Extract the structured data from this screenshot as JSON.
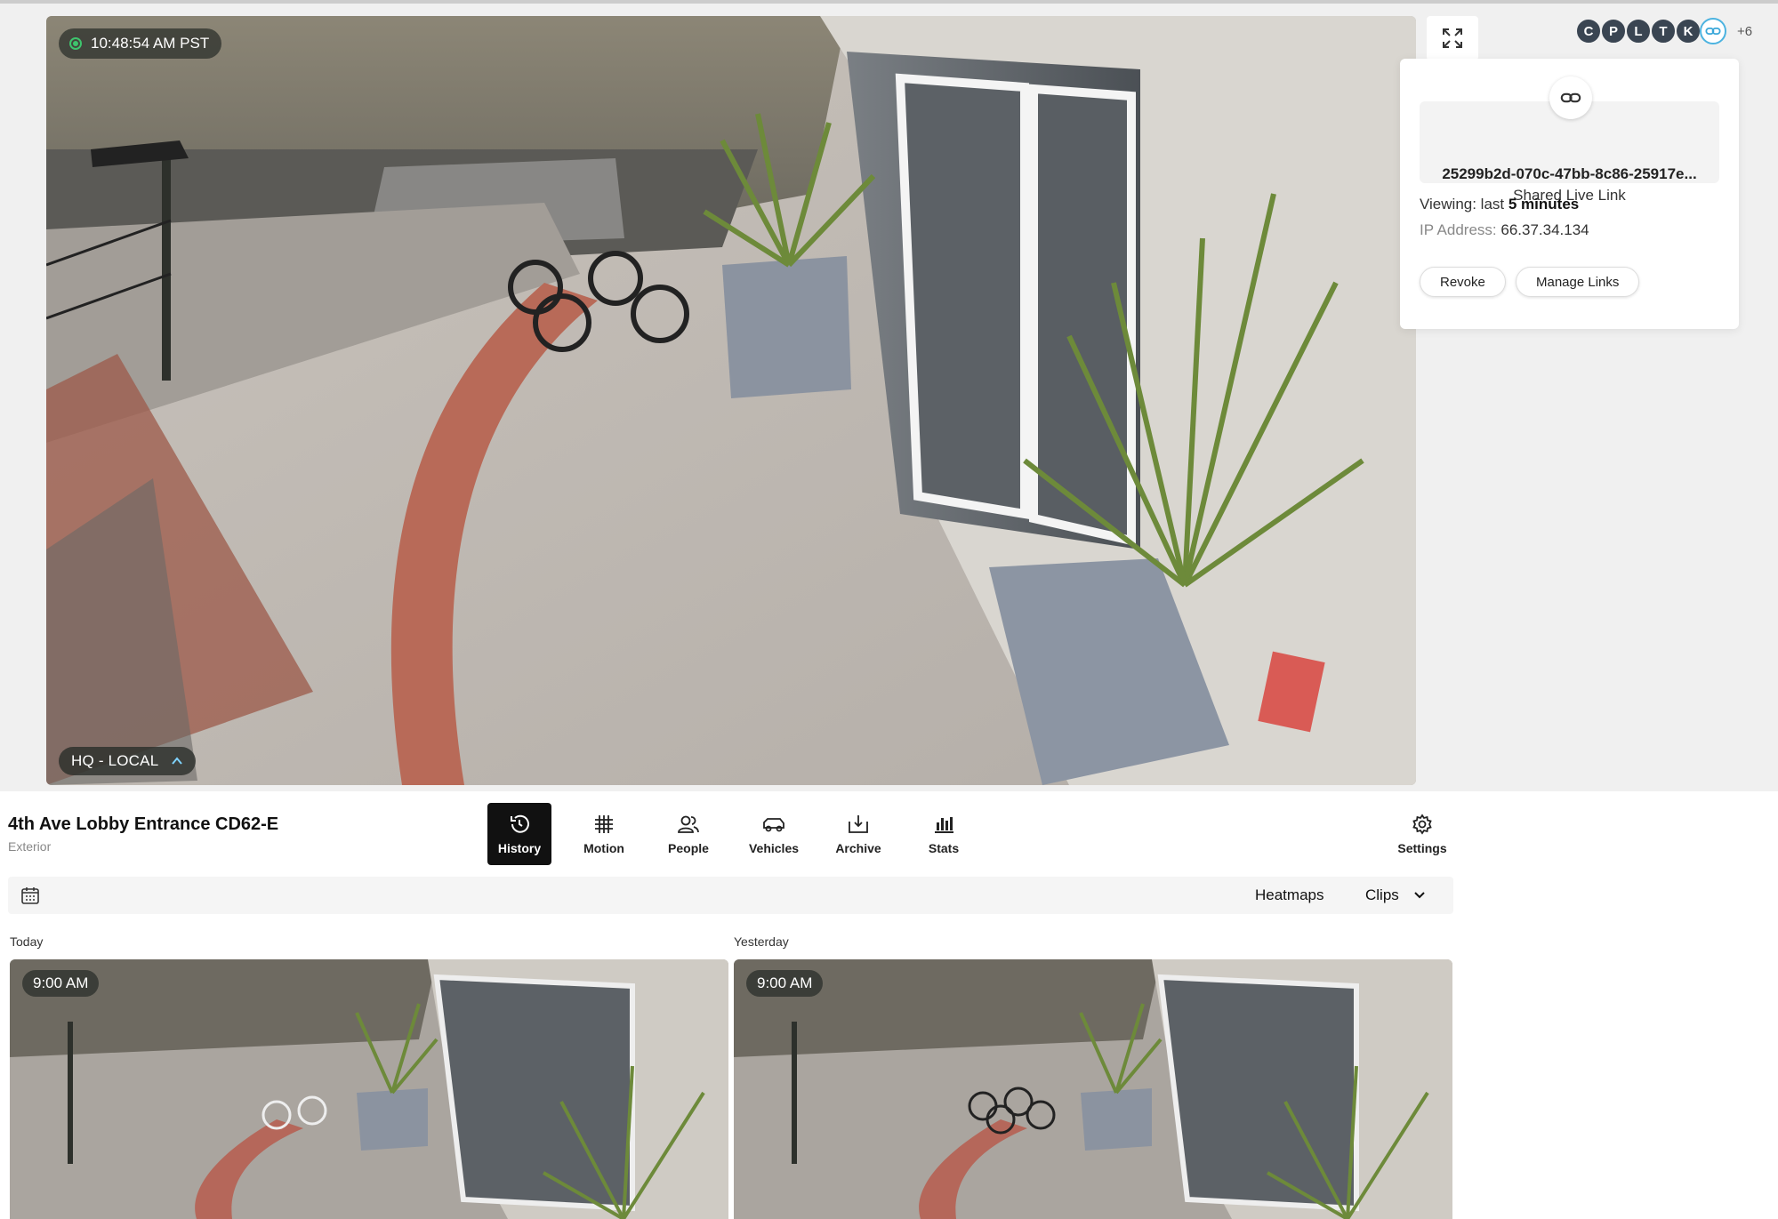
{
  "feed": {
    "timestamp": "10:48:54 AM PST",
    "quality": "HQ - LOCAL"
  },
  "viewers": {
    "initials": [
      "C",
      "P",
      "L",
      "T",
      "K"
    ],
    "more": "+6"
  },
  "share_popup": {
    "link_id": "25299b2d-070c-47bb-8c86-25917e...",
    "link_label": "Shared Live Link",
    "viewing_prefix": "Viewing: last",
    "viewing_value": "5 minutes",
    "ip_label": "IP Address:",
    "ip_value": "66.37.34.134",
    "revoke": "Revoke",
    "manage": "Manage Links"
  },
  "camera": {
    "name": "4th Ave Lobby Entrance CD62-E",
    "location": "Exterior"
  },
  "tabs": [
    {
      "label": "History",
      "icon": "history-icon",
      "active": true
    },
    {
      "label": "Motion",
      "icon": "grid-icon"
    },
    {
      "label": "People",
      "icon": "people-icon"
    },
    {
      "label": "Vehicles",
      "icon": "vehicle-icon"
    },
    {
      "label": "Archive",
      "icon": "archive-icon"
    },
    {
      "label": "Stats",
      "icon": "stats-icon"
    }
  ],
  "settings_label": "Settings",
  "toolbar": {
    "heatmaps": "Heatmaps",
    "clips": "Clips"
  },
  "history": [
    {
      "day": "Today",
      "time": "9:00 AM"
    },
    {
      "day": "Yesterday",
      "time": "9:00 AM"
    }
  ]
}
